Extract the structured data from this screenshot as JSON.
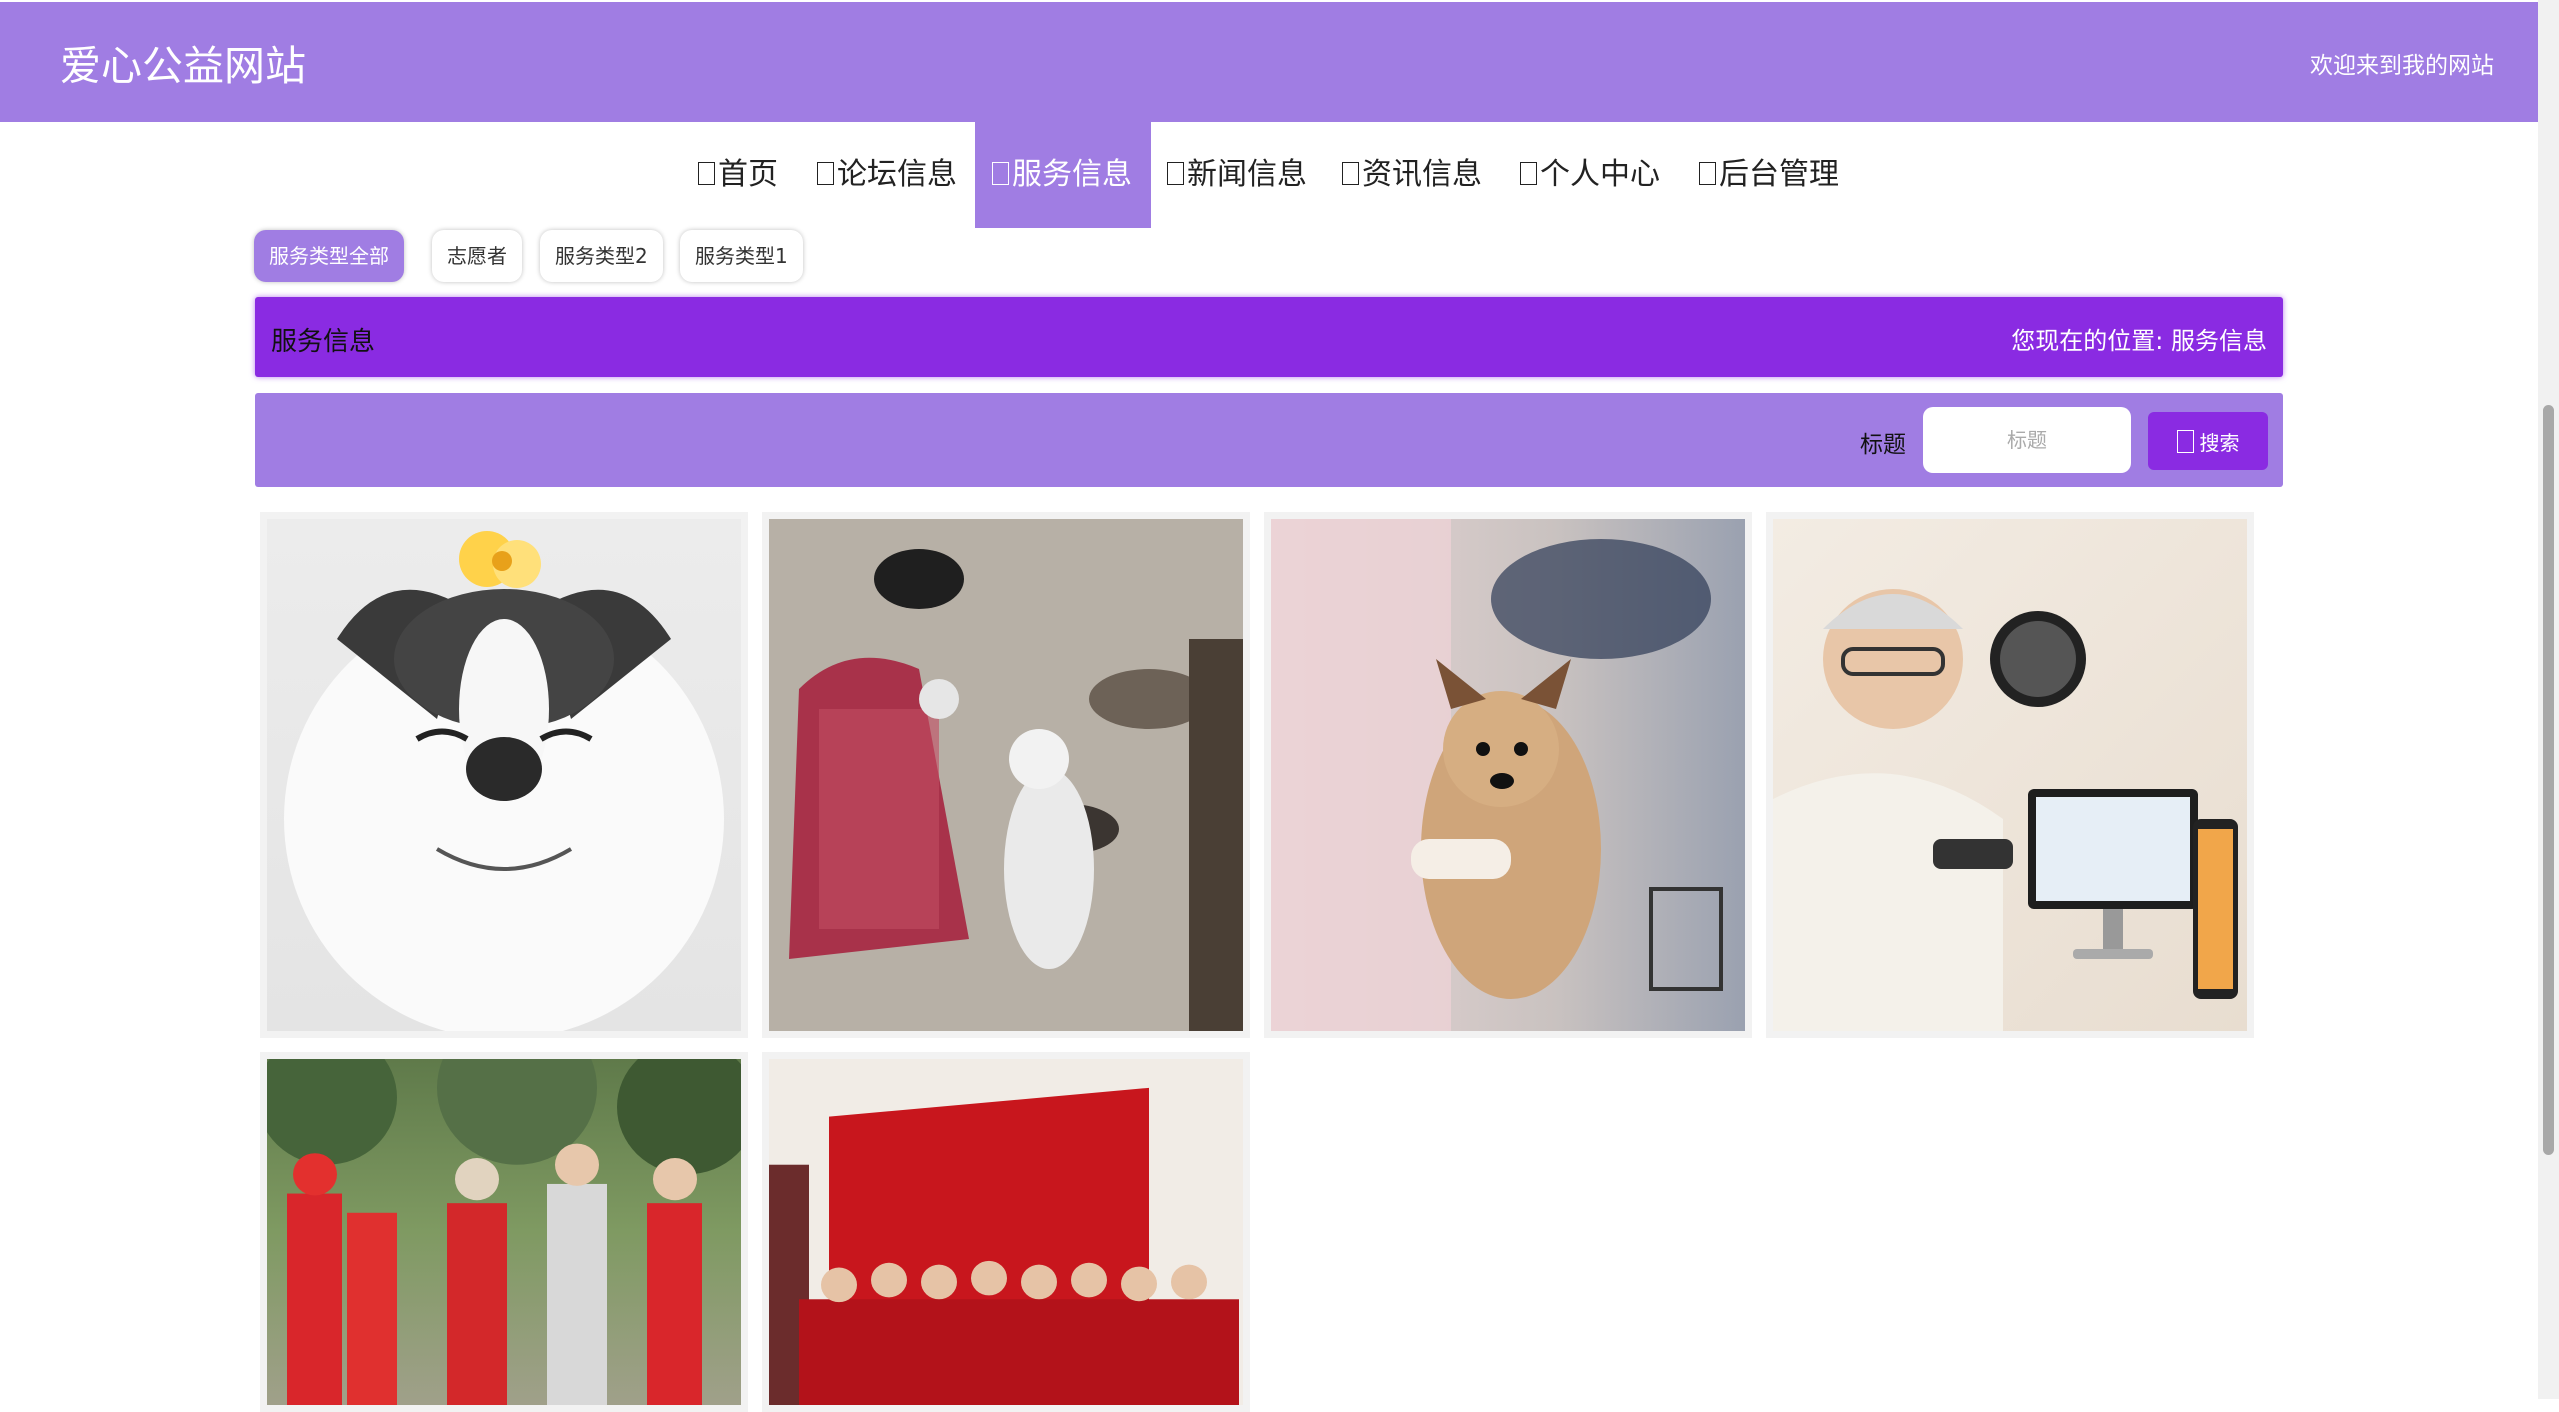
{
  "header": {
    "title": "爱心公益网站",
    "welcome": "欢迎来到我的网站"
  },
  "nav": {
    "items": [
      {
        "label": "首页"
      },
      {
        "label": "论坛信息"
      },
      {
        "label": "服务信息"
      },
      {
        "label": "新闻信息"
      },
      {
        "label": "资讯信息"
      },
      {
        "label": "个人中心"
      },
      {
        "label": "后台管理"
      }
    ],
    "active": "服务信息"
  },
  "filters": {
    "items": [
      {
        "label": "服务类型全部"
      },
      {
        "label": "志愿者"
      },
      {
        "label": "服务类型2"
      },
      {
        "label": "服务类型1"
      }
    ],
    "active": "服务类型全部"
  },
  "location": {
    "title": "服务信息",
    "prefix": "您现在的位置:",
    "current": "服务信息"
  },
  "search": {
    "label": "标题",
    "placeholder": "标题",
    "button": "搜索"
  },
  "cards": [
    {
      "image": "smiling-husky-with-flower"
    },
    {
      "image": "volunteer-with-dogs-at-shelter"
    },
    {
      "image": "person-holding-puppy"
    },
    {
      "image": "elderly-man-smartwatch-monitor"
    },
    {
      "image": "volunteers-in-red-vests-park"
    },
    {
      "image": "group-photo-red-banner-event"
    }
  ],
  "colors": {
    "header": "#a07de3",
    "accent": "#8a2be2",
    "nav_active": "#a07de3"
  }
}
